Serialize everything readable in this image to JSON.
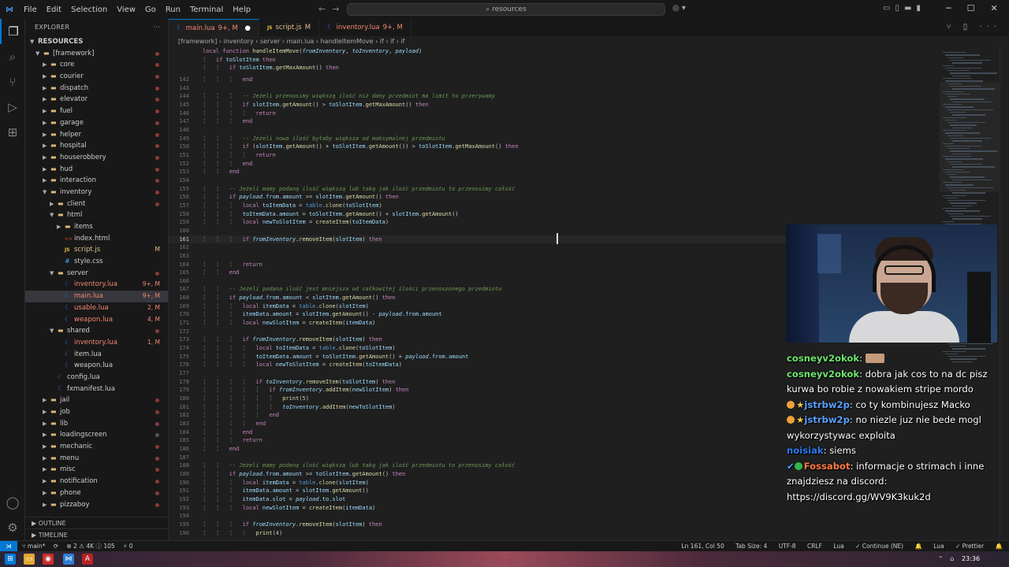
{
  "titlebar": {
    "menu": [
      "File",
      "Edit",
      "Selection",
      "View",
      "Go",
      "Run",
      "Terminal",
      "Help"
    ],
    "search": "resources"
  },
  "sidebar": {
    "title": "EXPLORER",
    "root": "RESOURCES",
    "items": [
      {
        "label": "[framework]",
        "depth": 1,
        "type": "folder",
        "open": true,
        "dot": "red"
      },
      {
        "label": "core",
        "depth": 2,
        "type": "folder",
        "dot": "red"
      },
      {
        "label": "courier",
        "depth": 2,
        "type": "folder",
        "dot": "red"
      },
      {
        "label": "dispatch",
        "depth": 2,
        "type": "folder",
        "dot": "red"
      },
      {
        "label": "elevator",
        "depth": 2,
        "type": "folder",
        "dot": "red"
      },
      {
        "label": "fuel",
        "depth": 2,
        "type": "folder",
        "dot": "red"
      },
      {
        "label": "garage",
        "depth": 2,
        "type": "folder",
        "dot": "red"
      },
      {
        "label": "helper",
        "depth": 2,
        "type": "folder",
        "dot": "red"
      },
      {
        "label": "hospital",
        "depth": 2,
        "type": "folder",
        "dot": "red"
      },
      {
        "label": "houserobbery",
        "depth": 2,
        "type": "folder",
        "dot": "red"
      },
      {
        "label": "hud",
        "depth": 2,
        "type": "folder",
        "dot": "red"
      },
      {
        "label": "interaction",
        "depth": 2,
        "type": "folder",
        "dot": "red"
      },
      {
        "label": "inventory",
        "depth": 2,
        "type": "folder",
        "open": true,
        "dot": "red"
      },
      {
        "label": "client",
        "depth": 3,
        "type": "folder",
        "dot": "red"
      },
      {
        "label": "html",
        "depth": 3,
        "type": "folder",
        "open": true
      },
      {
        "label": "items",
        "depth": 4,
        "type": "folder"
      },
      {
        "label": "index.html",
        "depth": 4,
        "type": "html"
      },
      {
        "label": "script.js",
        "depth": 4,
        "type": "js",
        "badge": "M",
        "bc": "mod"
      },
      {
        "label": "style.css",
        "depth": 4,
        "type": "css"
      },
      {
        "label": "server",
        "depth": 3,
        "type": "folder",
        "open": true,
        "dot": "red"
      },
      {
        "label": "inventory.lua",
        "depth": 4,
        "type": "lua",
        "badge": "9+, M",
        "bc": "err"
      },
      {
        "label": "main.lua",
        "depth": 4,
        "type": "lua",
        "badge": "9+, M",
        "bc": "err",
        "sel": true
      },
      {
        "label": "usable.lua",
        "depth": 4,
        "type": "lua",
        "badge": "2, M",
        "bc": "err"
      },
      {
        "label": "weapon.lua",
        "depth": 4,
        "type": "lua",
        "badge": "4, M",
        "bc": "err"
      },
      {
        "label": "shared",
        "depth": 3,
        "type": "folder",
        "open": true,
        "dot": "red"
      },
      {
        "label": "inventory.lua",
        "depth": 4,
        "type": "lua",
        "badge": "1, M",
        "bc": "err"
      },
      {
        "label": "item.lua",
        "depth": 4,
        "type": "lua"
      },
      {
        "label": "weapon.lua",
        "depth": 4,
        "type": "lua"
      },
      {
        "label": "config.lua",
        "depth": 3,
        "type": "lua"
      },
      {
        "label": "fxmanifest.lua",
        "depth": 3,
        "type": "lua"
      },
      {
        "label": "jail",
        "depth": 2,
        "type": "folder",
        "dot": "red"
      },
      {
        "label": "job",
        "depth": 2,
        "type": "folder",
        "dot": "red"
      },
      {
        "label": "lib",
        "depth": 2,
        "type": "folder",
        "dot": "red"
      },
      {
        "label": "loadingscreen",
        "depth": 2,
        "type": "folder",
        "dot": "grey"
      },
      {
        "label": "mechanic",
        "depth": 2,
        "type": "folder",
        "dot": "red"
      },
      {
        "label": "menu",
        "depth": 2,
        "type": "folder",
        "dot": "red"
      },
      {
        "label": "misc",
        "depth": 2,
        "type": "folder",
        "dot": "red"
      },
      {
        "label": "notification",
        "depth": 2,
        "type": "folder",
        "dot": "red"
      },
      {
        "label": "phone",
        "depth": 2,
        "type": "folder",
        "dot": "red"
      },
      {
        "label": "pizzaboy",
        "depth": 2,
        "type": "folder",
        "dot": "red"
      }
    ],
    "outline": "OUTLINE",
    "timeline": "TIMELINE"
  },
  "tabs": [
    {
      "label": "main.lua",
      "status": "9+, M",
      "active": true,
      "icon": "lua"
    },
    {
      "label": "script.js",
      "status": "M",
      "icon": "js"
    },
    {
      "label": "inventory.lua",
      "status": "9+, M",
      "icon": "lua"
    }
  ],
  "breadcrumb": "[framework] › inventory › server › main.lua › handleItemMove › if › if › if",
  "sticky": [
    {
      "n": "",
      "t": "local function handleItemMove(fromInventory, toInventory, payload)"
    },
    {
      "n": "",
      "t": "    if toSlotItem then"
    },
    {
      "n": "",
      "t": "        if toSlotItem.getMaxAmount() then"
    }
  ],
  "code": [
    {
      "n": "142",
      "t": "            end"
    },
    {
      "n": "143",
      "t": ""
    },
    {
      "n": "144",
      "t": "            -- Jeżeli przenosimy większą ilość niż dany przedmiot ma limit to przerywamy"
    },
    {
      "n": "145",
      "t": "            if slotItem.getAmount() > toSlotItem.getMaxAmount() then"
    },
    {
      "n": "146",
      "t": "                return"
    },
    {
      "n": "147",
      "t": "            end"
    },
    {
      "n": "148",
      "t": ""
    },
    {
      "n": "149",
      "t": "            -- Jeżeli nowa ilość byłaby większa od maksymalnej przedmiotu"
    },
    {
      "n": "150",
      "t": "            if (slotItem.getAmount() + toSlotItem.getAmount()) > toSlotItem.getMaxAmount() then"
    },
    {
      "n": "151",
      "t": "                return"
    },
    {
      "n": "152",
      "t": "            end"
    },
    {
      "n": "153",
      "t": "        end"
    },
    {
      "n": "154",
      "t": ""
    },
    {
      "n": "155",
      "t": "        -- Jeżeli mamy podaną ilość większą lub taką jak ilość przedmiotu to przenosimy całość"
    },
    {
      "n": "156",
      "t": "        if payload.from.amount >= slotItem.getAmount() then"
    },
    {
      "n": "157",
      "t": "            local toItemData = table.clone(toSlotItem)"
    },
    {
      "n": "158",
      "t": "            toItemData.amount = toSlotItem.getAmount() + slotItem.getAmount()"
    },
    {
      "n": "159",
      "t": "            local newToSlotItem = createItem(toItemData)"
    },
    {
      "n": "160",
      "t": ""
    },
    {
      "n": "161",
      "t": "            if fromInventory.removeItem(slotItem) then",
      "cur": true
    },
    {
      "n": "162",
      "t": ""
    },
    {
      "n": "163",
      "t": ""
    },
    {
      "n": "164",
      "t": "            return"
    },
    {
      "n": "165",
      "t": "        end"
    },
    {
      "n": "166",
      "t": ""
    },
    {
      "n": "167",
      "t": "        -- Jeżeli podana ilość jest mniejsza od całkowitej ilości przenoszonego przedmiotu"
    },
    {
      "n": "168",
      "t": "        if payload.from.amount < slotItem.getAmount() then"
    },
    {
      "n": "169",
      "t": "            local itemData = table.clone(slotItem)"
    },
    {
      "n": "170",
      "t": "            itemData.amount = slotItem.getAmount() - payload.from.amount"
    },
    {
      "n": "171",
      "t": "            local newSlotItem = createItem(itemData)"
    },
    {
      "n": "172",
      "t": ""
    },
    {
      "n": "173",
      "t": "            if fromInventory.removeItem(slotItem) then"
    },
    {
      "n": "174",
      "t": "                local toItemData = table.clone(toSlotItem)"
    },
    {
      "n": "175",
      "t": "                toItemData.amount = toSlotItem.getAmount() + payload.from.amount"
    },
    {
      "n": "176",
      "t": "                local newToSlotItem = createItem(toItemData)"
    },
    {
      "n": "177",
      "t": ""
    },
    {
      "n": "178",
      "t": "                if toInventory.removeItem(toSlotItem) then"
    },
    {
      "n": "179",
      "t": "                    if fromInventory.addItem(newSlotItem) then"
    },
    {
      "n": "180",
      "t": "                        print(5)"
    },
    {
      "n": "181",
      "t": "                        toInventory.addItem(newToSlotItem)"
    },
    {
      "n": "182",
      "t": "                    end"
    },
    {
      "n": "183",
      "t": "                end"
    },
    {
      "n": "184",
      "t": "            end"
    },
    {
      "n": "185",
      "t": "            return"
    },
    {
      "n": "186",
      "t": "        end"
    },
    {
      "n": "187",
      "t": ""
    },
    {
      "n": "188",
      "t": "        -- Jeżeli mamy podaną ilość większą lub taką jak ilość przedmiotu to przenosimy całość"
    },
    {
      "n": "189",
      "t": "        if payload.from.amount >= toSlotItem.getAmount() then"
    },
    {
      "n": "190",
      "t": "            local itemData = table.clone(slotItem)"
    },
    {
      "n": "191",
      "t": "            itemData.amount = slotItem.getAmount()"
    },
    {
      "n": "192",
      "t": "            itemData.slot = payload.to.slot"
    },
    {
      "n": "193",
      "t": "            local newSlotItem = createItem(itemData)"
    },
    {
      "n": "194",
      "t": ""
    },
    {
      "n": "195",
      "t": "            if fromInventory.removeItem(slotItem) then"
    },
    {
      "n": "196",
      "t": "                print(4)"
    }
  ],
  "chat": {
    "messages": [
      {
        "user": "cosneyv2okok",
        "uc": "u1",
        "text": "",
        "emote": true
      },
      {
        "user": "cosneyv2okok",
        "uc": "u1",
        "text": "dobra jak cos to na dc pisz kurwa bo robie z nowakiem stripe mordo"
      },
      {
        "user": "jstrbw2p",
        "uc": "u2",
        "badges": true,
        "text": "co ty kombinujesz Macko"
      },
      {
        "user": "jstrbw2p",
        "uc": "u2",
        "badges": true,
        "text": "no niezle juz nie bede mogl wykorzystywac exploita"
      },
      {
        "user": "noisiak",
        "uc": "u3",
        "text": "siems"
      },
      {
        "user": "Fossabot",
        "uc": "u4",
        "bot": true,
        "text": "informacje o strimach i inne znajdziesz na discord: https://discord.gg/WV9K3kuk2d"
      }
    ]
  },
  "statusbar": {
    "branch": "main*",
    "problems": "⊗ 2 ⚠ 4K ⓘ 105",
    "ports": "⚡ 0",
    "position": "Ln 161, Col 50",
    "tab_size": "Tab Size: 4",
    "encoding": "UTF-8",
    "eol": "CRLF",
    "language": "Lua",
    "continue": "✓ Continue (NE)",
    "lua_badge": "Lua",
    "prettier": "✓ Prettier"
  },
  "taskbar": {
    "time": "23:36"
  }
}
